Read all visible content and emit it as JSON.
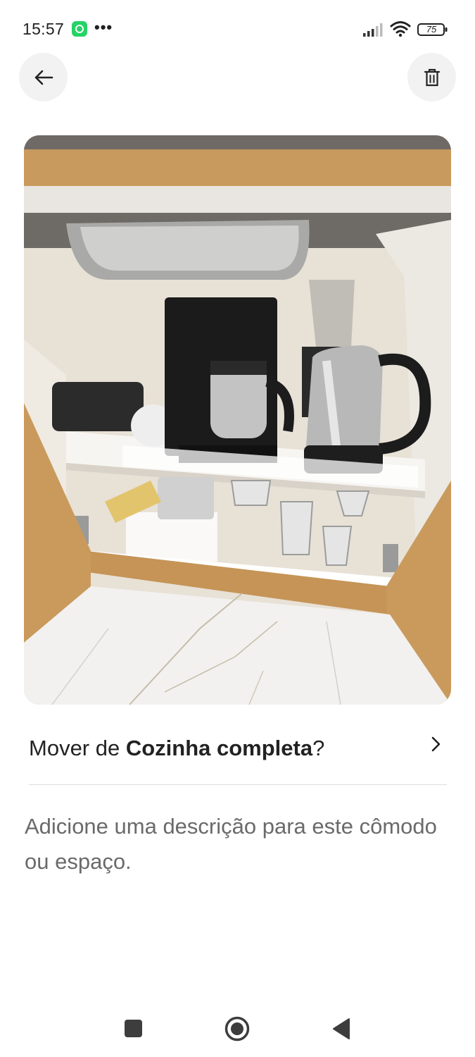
{
  "status_bar": {
    "time": "15:57",
    "notification_icon": "whatsapp-icon",
    "more_indicator": "•••",
    "battery_level": "75"
  },
  "header": {
    "back_icon": "arrow-left-icon",
    "delete_icon": "trash-icon"
  },
  "photo": {
    "subject": "kitchen-cabinet-photo"
  },
  "move_row": {
    "prefix": "Mover de ",
    "room": "Cozinha completa",
    "suffix": "?"
  },
  "description": {
    "placeholder": "Adicione uma descrição para este cômodo ou espaço."
  },
  "nav_bar": {
    "recent_icon": "square-icon",
    "home_icon": "circle-icon",
    "back_icon": "triangle-back-icon"
  },
  "colors": {
    "text_primary": "#222222",
    "text_secondary": "#6a6a6a",
    "button_bg": "#f2f2f2",
    "divider": "#dddddd"
  }
}
